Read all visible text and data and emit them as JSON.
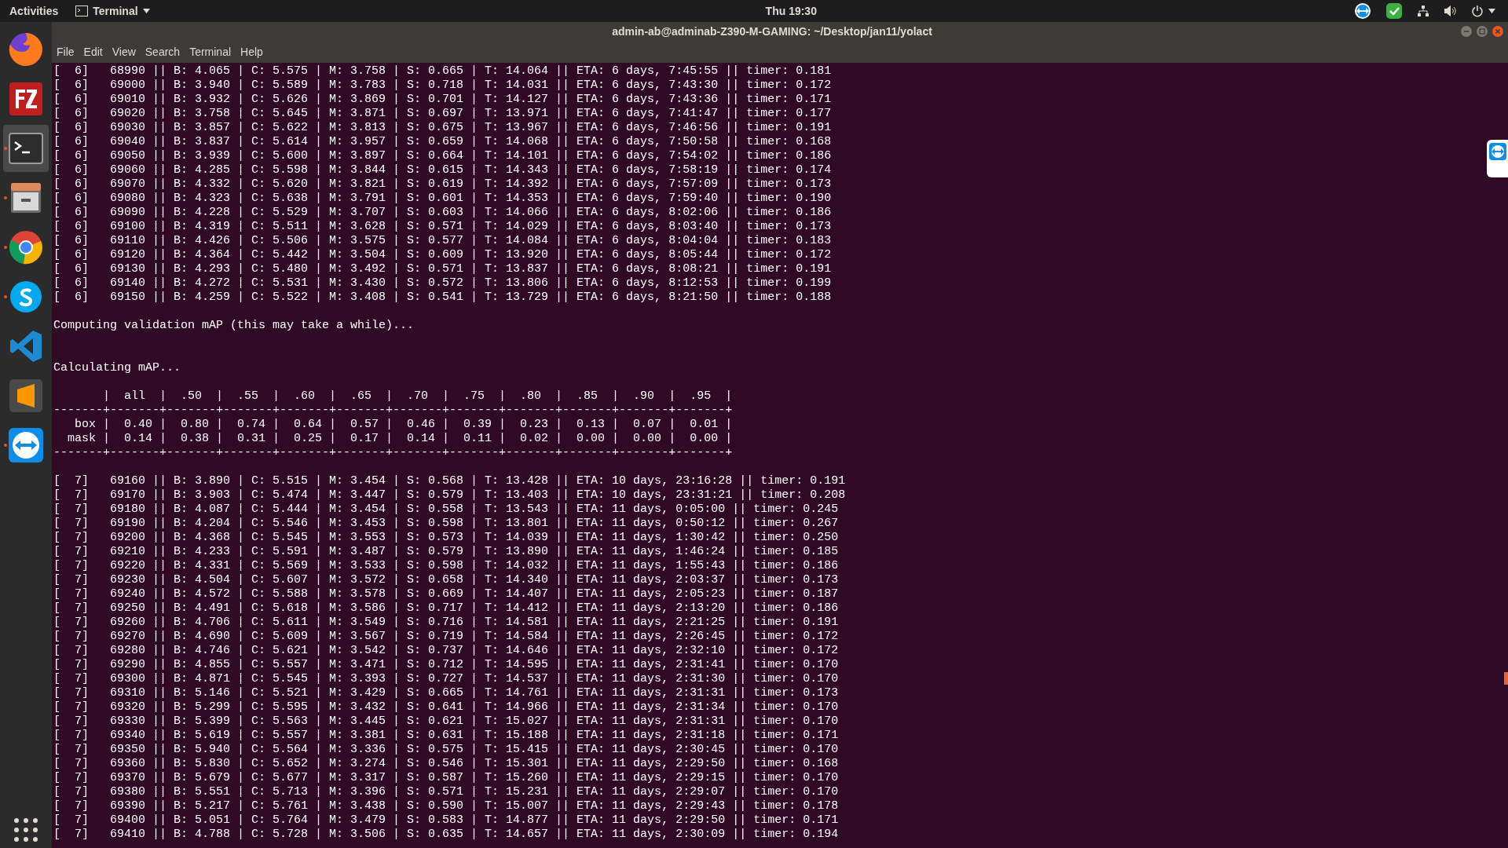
{
  "top_bar": {
    "activities": "Activities",
    "app_menu": "Terminal",
    "clock": "Thu 19:30"
  },
  "dock": {
    "items": [
      {
        "kind": "browser",
        "running": false,
        "selected": false
      },
      {
        "kind": "ftp",
        "running": false,
        "selected": false
      },
      {
        "kind": "terminal",
        "running": true,
        "selected": true
      },
      {
        "kind": "files",
        "running": true,
        "selected": false
      },
      {
        "kind": "chrome",
        "running": true,
        "selected": false
      },
      {
        "kind": "skype",
        "running": true,
        "selected": false
      },
      {
        "kind": "code",
        "running": false,
        "selected": false
      },
      {
        "kind": "sublime",
        "running": false,
        "selected": false
      },
      {
        "kind": "remote",
        "running": true,
        "selected": false
      }
    ]
  },
  "window": {
    "title": "admin-ab@adminab-Z390-M-GAMING: ~/Desktop/jan11/yolact",
    "menu": [
      "File",
      "Edit",
      "View",
      "Search",
      "Terminal",
      "Help"
    ],
    "terminal": {
      "blocks": [
        {
          "kind": "log",
          "lines": [
            "[  6]   68990 || B: 4.065 | C: 5.575 | M: 3.758 | S: 0.665 | T: 14.064 || ETA: 6 days, 7:45:55 || timer: 0.181",
            "[  6]   69000 || B: 3.940 | C: 5.589 | M: 3.783 | S: 0.718 | T: 14.031 || ETA: 6 days, 7:43:30 || timer: 0.172",
            "[  6]   69010 || B: 3.932 | C: 5.626 | M: 3.869 | S: 0.701 | T: 14.127 || ETA: 6 days, 7:43:36 || timer: 0.171",
            "[  6]   69020 || B: 3.758 | C: 5.645 | M: 3.871 | S: 0.697 | T: 13.971 || ETA: 6 days, 7:41:47 || timer: 0.177",
            "[  6]   69030 || B: 3.857 | C: 5.622 | M: 3.813 | S: 0.675 | T: 13.967 || ETA: 6 days, 7:46:56 || timer: 0.191",
            "[  6]   69040 || B: 3.837 | C: 5.614 | M: 3.957 | S: 0.659 | T: 14.068 || ETA: 6 days, 7:50:58 || timer: 0.168",
            "[  6]   69050 || B: 3.939 | C: 5.600 | M: 3.897 | S: 0.664 | T: 14.101 || ETA: 6 days, 7:54:02 || timer: 0.186",
            "[  6]   69060 || B: 4.285 | C: 5.598 | M: 3.844 | S: 0.615 | T: 14.343 || ETA: 6 days, 7:58:19 || timer: 0.174",
            "[  6]   69070 || B: 4.332 | C: 5.620 | M: 3.821 | S: 0.619 | T: 14.392 || ETA: 6 days, 7:57:09 || timer: 0.173",
            "[  6]   69080 || B: 4.323 | C: 5.638 | M: 3.791 | S: 0.601 | T: 14.353 || ETA: 6 days, 7:59:40 || timer: 0.190",
            "[  6]   69090 || B: 4.228 | C: 5.529 | M: 3.707 | S: 0.603 | T: 14.066 || ETA: 6 days, 8:02:06 || timer: 0.186",
            "[  6]   69100 || B: 4.319 | C: 5.511 | M: 3.628 | S: 0.571 | T: 14.029 || ETA: 6 days, 8:03:40 || timer: 0.173",
            "[  6]   69110 || B: 4.426 | C: 5.506 | M: 3.575 | S: 0.577 | T: 14.084 || ETA: 6 days, 8:04:04 || timer: 0.183",
            "[  6]   69120 || B: 4.364 | C: 5.442 | M: 3.504 | S: 0.609 | T: 13.920 || ETA: 6 days, 8:05:44 || timer: 0.172",
            "[  6]   69130 || B: 4.293 | C: 5.480 | M: 3.492 | S: 0.571 | T: 13.837 || ETA: 6 days, 8:08:21 || timer: 0.191",
            "[  6]   69140 || B: 4.272 | C: 5.531 | M: 3.430 | S: 0.572 | T: 13.806 || ETA: 6 days, 8:12:53 || timer: 0.199",
            "[  6]   69150 || B: 4.259 | C: 5.522 | M: 3.408 | S: 0.541 | T: 13.729 || ETA: 6 days, 8:21:50 || timer: 0.188"
          ]
        },
        {
          "kind": "status",
          "lines": [
            "Computing validation mAP (this may take a while)..."
          ]
        },
        {
          "kind": "status",
          "lines": [
            "Calculating mAP..."
          ]
        },
        {
          "kind": "table",
          "lines": [
            "       |  all  |  .50  |  .55  |  .60  |  .65  |  .70  |  .75  |  .80  |  .85  |  .90  |  .95  |",
            "-------+-------+-------+-------+-------+-------+-------+-------+-------+-------+-------+-------+",
            "   box |  0.40 |  0.80 |  0.74 |  0.64 |  0.57 |  0.46 |  0.39 |  0.23 |  0.13 |  0.07 |  0.01 |",
            "  mask |  0.14 |  0.38 |  0.31 |  0.25 |  0.17 |  0.14 |  0.11 |  0.02 |  0.00 |  0.00 |  0.00 |",
            "-------+-------+-------+-------+-------+-------+-------+-------+-------+-------+-------+-------+"
          ]
        },
        {
          "kind": "log",
          "lines": [
            "[  7]   69160 || B: 3.890 | C: 5.515 | M: 3.454 | S: 0.568 | T: 13.428 || ETA: 10 days, 23:16:28 || timer: 0.191",
            "[  7]   69170 || B: 3.903 | C: 5.474 | M: 3.447 | S: 0.579 | T: 13.403 || ETA: 10 days, 23:31:21 || timer: 0.208",
            "[  7]   69180 || B: 4.087 | C: 5.444 | M: 3.454 | S: 0.558 | T: 13.543 || ETA: 11 days, 0:05:00 || timer: 0.245",
            "[  7]   69190 || B: 4.204 | C: 5.546 | M: 3.453 | S: 0.598 | T: 13.801 || ETA: 11 days, 0:50:12 || timer: 0.267",
            "[  7]   69200 || B: 4.368 | C: 5.545 | M: 3.553 | S: 0.573 | T: 14.039 || ETA: 11 days, 1:30:42 || timer: 0.250",
            "[  7]   69210 || B: 4.233 | C: 5.591 | M: 3.487 | S: 0.579 | T: 13.890 || ETA: 11 days, 1:46:24 || timer: 0.185",
            "[  7]   69220 || B: 4.331 | C: 5.569 | M: 3.533 | S: 0.598 | T: 14.032 || ETA: 11 days, 1:55:43 || timer: 0.186",
            "[  7]   69230 || B: 4.504 | C: 5.607 | M: 3.572 | S: 0.658 | T: 14.340 || ETA: 11 days, 2:03:37 || timer: 0.173",
            "[  7]   69240 || B: 4.572 | C: 5.588 | M: 3.578 | S: 0.669 | T: 14.407 || ETA: 11 days, 2:05:23 || timer: 0.187",
            "[  7]   69250 || B: 4.491 | C: 5.618 | M: 3.586 | S: 0.717 | T: 14.412 || ETA: 11 days, 2:13:20 || timer: 0.186",
            "[  7]   69260 || B: 4.706 | C: 5.611 | M: 3.549 | S: 0.716 | T: 14.581 || ETA: 11 days, 2:21:25 || timer: 0.191",
            "[  7]   69270 || B: 4.690 | C: 5.609 | M: 3.567 | S: 0.719 | T: 14.584 || ETA: 11 days, 2:26:45 || timer: 0.172",
            "[  7]   69280 || B: 4.746 | C: 5.621 | M: 3.542 | S: 0.737 | T: 14.646 || ETA: 11 days, 2:32:10 || timer: 0.172",
            "[  7]   69290 || B: 4.855 | C: 5.557 | M: 3.471 | S: 0.712 | T: 14.595 || ETA: 11 days, 2:31:41 || timer: 0.170",
            "[  7]   69300 || B: 4.871 | C: 5.545 | M: 3.393 | S: 0.727 | T: 14.537 || ETA: 11 days, 2:31:30 || timer: 0.170",
            "[  7]   69310 || B: 5.146 | C: 5.521 | M: 3.429 | S: 0.665 | T: 14.761 || ETA: 11 days, 2:31:31 || timer: 0.173",
            "[  7]   69320 || B: 5.299 | C: 5.595 | M: 3.432 | S: 0.641 | T: 14.966 || ETA: 11 days, 2:31:34 || timer: 0.170",
            "[  7]   69330 || B: 5.399 | C: 5.563 | M: 3.445 | S: 0.621 | T: 15.027 || ETA: 11 days, 2:31:31 || timer: 0.170",
            "[  7]   69340 || B: 5.619 | C: 5.557 | M: 3.381 | S: 0.631 | T: 15.188 || ETA: 11 days, 2:31:18 || timer: 0.171",
            "[  7]   69350 || B: 5.940 | C: 5.564 | M: 3.336 | S: 0.575 | T: 15.415 || ETA: 11 days, 2:30:45 || timer: 0.170",
            "[  7]   69360 || B: 5.830 | C: 5.652 | M: 3.274 | S: 0.546 | T: 15.301 || ETA: 11 days, 2:29:50 || timer: 0.168",
            "[  7]   69370 || B: 5.679 | C: 5.677 | M: 3.317 | S: 0.587 | T: 15.260 || ETA: 11 days, 2:29:15 || timer: 0.170",
            "[  7]   69380 || B: 5.551 | C: 5.713 | M: 3.396 | S: 0.571 | T: 15.231 || ETA: 11 days, 2:29:07 || timer: 0.170",
            "[  7]   69390 || B: 5.217 | C: 5.761 | M: 3.438 | S: 0.590 | T: 15.007 || ETA: 11 days, 2:29:43 || timer: 0.178",
            "[  7]   69400 || B: 5.051 | C: 5.764 | M: 3.479 | S: 0.583 | T: 14.877 || ETA: 11 days, 2:29:50 || timer: 0.171",
            "[  7]   69410 || B: 4.788 | C: 5.728 | M: 3.506 | S: 0.635 | T: 14.657 || ETA: 11 days, 2:30:09 || timer: 0.194"
          ]
        }
      ]
    }
  }
}
